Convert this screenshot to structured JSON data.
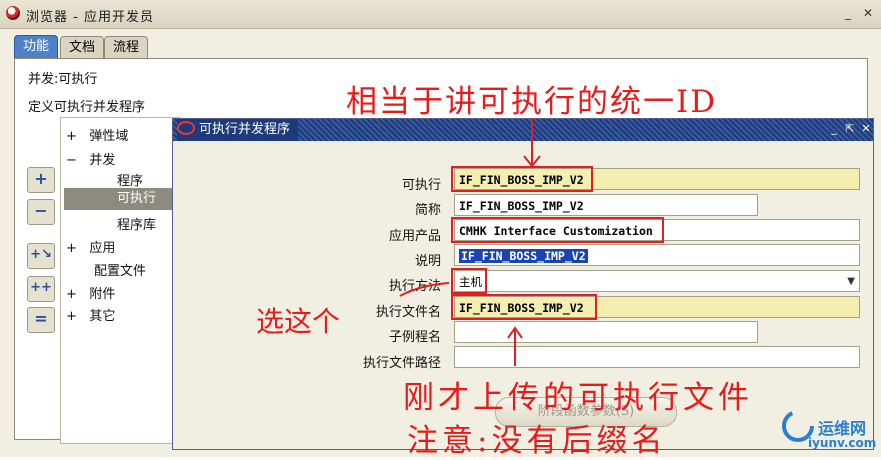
{
  "window": {
    "title": "浏览器 - 应用开发员"
  },
  "tabs": [
    {
      "label": "功能",
      "active": true
    },
    {
      "label": "文档",
      "active": false
    },
    {
      "label": "流程",
      "active": false
    }
  ],
  "main": {
    "heading": "并发:可执行",
    "subheading": "定义可执行并发程序"
  },
  "tree": {
    "items": [
      {
        "prefix": "+",
        "label": "弹性域"
      },
      {
        "prefix": "−",
        "label": "并发"
      },
      {
        "prefix": "",
        "label": "程序"
      },
      {
        "prefix": "",
        "label": "可执行",
        "selected": true
      },
      {
        "prefix": "",
        "label": "程序库"
      },
      {
        "prefix": "+",
        "label": "应用"
      },
      {
        "prefix": "",
        "label": "配置文件"
      },
      {
        "prefix": "+",
        "label": "附件"
      },
      {
        "prefix": "+",
        "label": "其它"
      }
    ]
  },
  "dialog": {
    "title": "可执行并发程序",
    "fields": {
      "executable": {
        "label": "可执行",
        "value": "IF_FIN_BOSS_IMP_V2"
      },
      "short_name": {
        "label": "简称",
        "value": "IF_FIN_BOSS_IMP_V2"
      },
      "application": {
        "label": "应用产品",
        "value": "CMHK Interface Customization"
      },
      "description": {
        "label": "说明",
        "value": "IF_FIN_BOSS_IMP_V2"
      },
      "method": {
        "label": "执行方法",
        "value": "主机"
      },
      "exec_file": {
        "label": "执行文件名",
        "value": "IF_FIN_BOSS_IMP_V2"
      },
      "subroutine": {
        "label": "子例程名",
        "value": ""
      },
      "exec_path": {
        "label": "执行文件路径",
        "value": ""
      }
    },
    "stage_button": "阶段函数参数(S)"
  },
  "annotations": {
    "note1": "相当于讲可执行的统一ID",
    "note2": "选这个",
    "note3": "刚才上传的可执行文件",
    "note4": "注意:没有后缀名"
  },
  "watermark": {
    "name": "运维网",
    "url": "iyunv.com"
  },
  "colors": {
    "required_field": "#f4eeb0",
    "annotation_red": "#e02020",
    "active_tab": "#4d82c9"
  }
}
